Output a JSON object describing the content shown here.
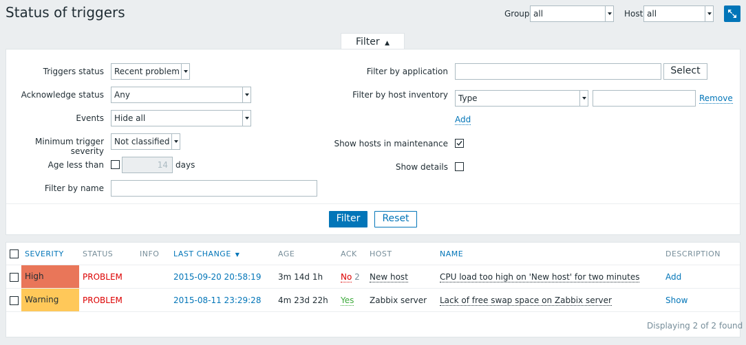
{
  "page": {
    "title": "Status of triggers"
  },
  "header": {
    "group_label": "Group",
    "group_value": "all",
    "host_label": "Host",
    "host_value": "all",
    "fullscreen_icon": "fullscreen-icon"
  },
  "filter_tab": {
    "label": "Filter",
    "arrow": "▲"
  },
  "filter": {
    "triggers_status": {
      "label": "Triggers status",
      "value": "Recent problem"
    },
    "acknowledge_status": {
      "label": "Acknowledge status",
      "value": "Any"
    },
    "events": {
      "label": "Events",
      "value": "Hide all"
    },
    "min_severity": {
      "label": "Minimum trigger severity",
      "value": "Not classified"
    },
    "age_less_than": {
      "label": "Age less than",
      "value": "14",
      "unit": "days",
      "checked": false
    },
    "filter_by_name": {
      "label": "Filter by name",
      "value": ""
    },
    "filter_by_application": {
      "label": "Filter by application",
      "value": "",
      "select_label": "Select"
    },
    "host_inventory": {
      "label": "Filter by host inventory",
      "field": "Type",
      "value": "",
      "remove_label": "Remove",
      "add_label": "Add"
    },
    "show_maintenance": {
      "label": "Show hosts in maintenance",
      "checked": true
    },
    "show_details": {
      "label": "Show details",
      "checked": false
    },
    "filter_button": "Filter",
    "reset_button": "Reset"
  },
  "table": {
    "columns": [
      "SEVERITY",
      "STATUS",
      "INFO",
      "LAST CHANGE",
      "AGE",
      "ACK",
      "HOST",
      "NAME",
      "DESCRIPTION"
    ],
    "sort_indicator": "▼",
    "rows": [
      {
        "severity": "High",
        "status": "PROBLEM",
        "info": "",
        "last_change": "2015-09-20 20:58:19",
        "age": "3m 14d 1h",
        "ack": "No",
        "ack_count": "2",
        "host": "New host",
        "name": "CPU load too high on 'New host' for two minutes",
        "description": "Add"
      },
      {
        "severity": "Warning",
        "status": "PROBLEM",
        "info": "",
        "last_change": "2015-08-11 23:29:28",
        "age": "4m 23d 22h",
        "ack": "Yes",
        "ack_count": "",
        "host": "Zabbix server",
        "name": "Lack of free swap space on Zabbix server",
        "description": "Show"
      }
    ],
    "footer": "Displaying 2 of 2 found"
  },
  "colors": {
    "accent": "#0275b8",
    "severity_high": "#e97659",
    "severity_warning": "#ffc859",
    "problem": "#dc0000",
    "ack_yes": "#3daa3b"
  }
}
